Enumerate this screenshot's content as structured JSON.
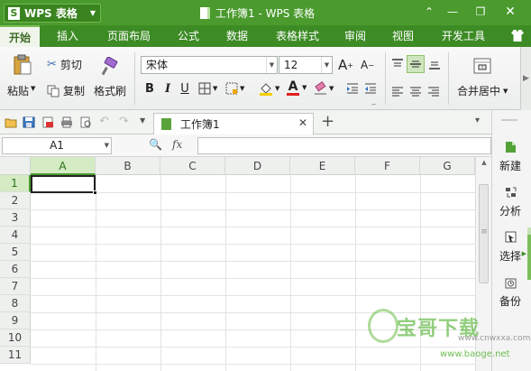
{
  "titlebar": {
    "app_name": "WPS 表格",
    "logo_letter": "S",
    "document_title": "工作簿1 - WPS 表格"
  },
  "menu_tabs": [
    {
      "label": "开始",
      "active": true
    },
    {
      "label": "插入",
      "active": false
    },
    {
      "label": "页面布局",
      "active": false
    },
    {
      "label": "公式",
      "active": false
    },
    {
      "label": "数据",
      "active": false
    },
    {
      "label": "表格样式",
      "active": false
    },
    {
      "label": "审阅",
      "active": false
    },
    {
      "label": "视图",
      "active": false
    },
    {
      "label": "开发工具",
      "active": false
    }
  ],
  "ribbon": {
    "paste": "粘贴",
    "cut": "剪切",
    "copy": "复制",
    "format_painter": "格式刷",
    "font_name": "宋体",
    "font_size": "12",
    "bold": "B",
    "italic": "I",
    "underline": "U",
    "font_color_letter": "A",
    "grow_font": "A",
    "shrink_font": "A",
    "merge_center": "合并居中"
  },
  "quick_access": {
    "doc_tab_label": "工作簿1"
  },
  "formula_bar": {
    "name_box": "A1",
    "fx_label": "fx",
    "formula_value": ""
  },
  "grid": {
    "columns": [
      "A",
      "B",
      "C",
      "D",
      "E",
      "F",
      "G"
    ],
    "rows": [
      "1",
      "2",
      "3",
      "4",
      "5",
      "6",
      "7",
      "8",
      "9",
      "10",
      "11"
    ],
    "selected_cell": "A1"
  },
  "right_pane": {
    "items": [
      {
        "label": "新建",
        "icon": "new-doc-icon"
      },
      {
        "label": "分析",
        "icon": "analyze-icon"
      },
      {
        "label": "选择",
        "icon": "select-icon"
      },
      {
        "label": "备份",
        "icon": "backup-icon"
      }
    ]
  },
  "watermark": {
    "brand": "宝哥下载",
    "small_text": "www.cnwxxa.com",
    "url": "www.baoge.net"
  },
  "colors": {
    "title_green": "#4a9a2d",
    "menu_green": "#3d8b25",
    "accent": "#4caf2a"
  }
}
